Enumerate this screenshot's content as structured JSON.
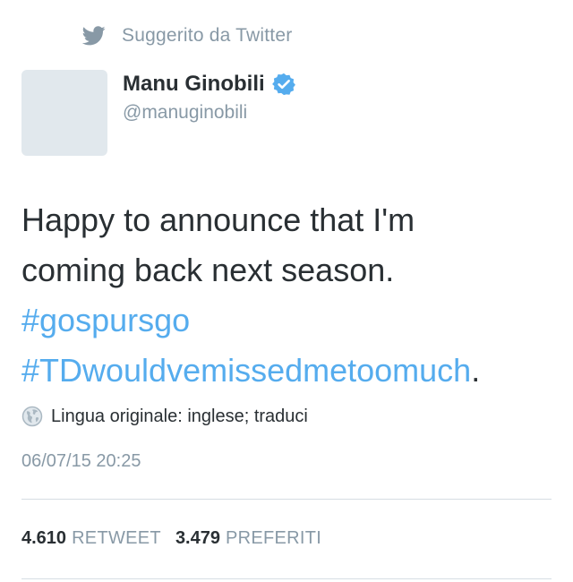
{
  "suggested": {
    "icon": "twitter-bird-icon",
    "label": "Suggerito da Twitter"
  },
  "user": {
    "display_name": "Manu Ginobili",
    "verified_icon": "verified-badge-icon",
    "handle": "@manuginobili"
  },
  "tweet": {
    "line1": "Happy to announce that I'm",
    "line2": "coming back next season.",
    "hashtag1": "#gospursgo",
    "hashtag2": "#TDwouldvemissedmetoomuch",
    "trailing": "."
  },
  "translate": {
    "icon": "globe-icon",
    "label": "Lingua originale: inglese; traduci"
  },
  "timestamp": "06/07/15 20:25",
  "stats": {
    "retweets_count": "4.610",
    "retweets_label": "RETWEET",
    "favorites_count": "3.479",
    "favorites_label": "PREFERITI"
  },
  "colors": {
    "accent": "#55acee",
    "muted": "#8899a6",
    "text": "#292f33",
    "avatar_placeholder": "#e1e8ed"
  }
}
